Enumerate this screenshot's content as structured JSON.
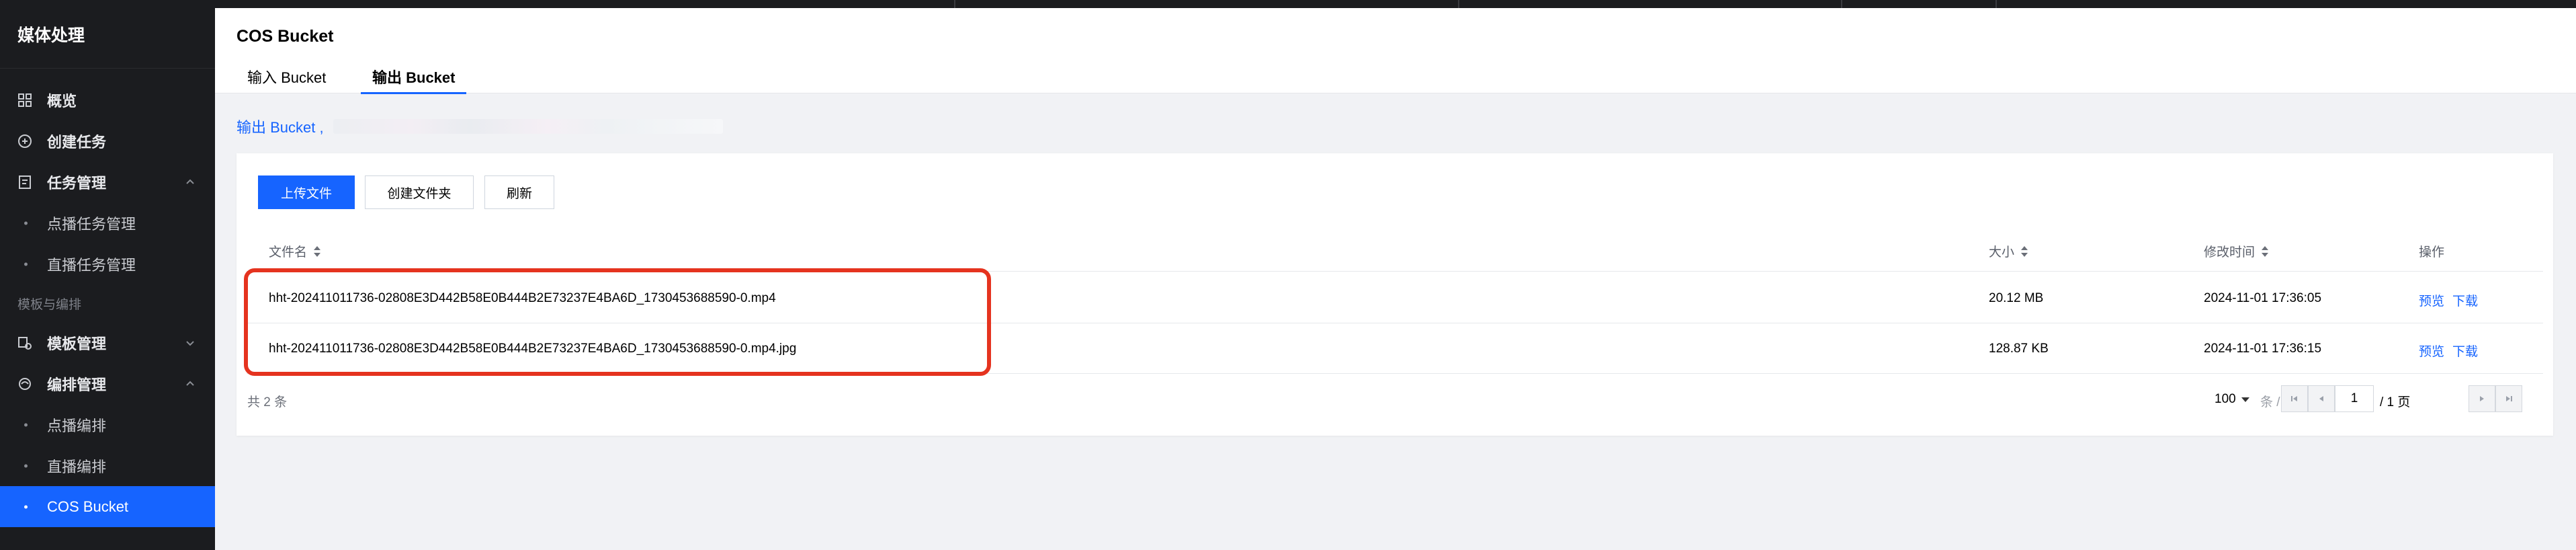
{
  "sidebar": {
    "brand": "媒体处理",
    "items": [
      {
        "label": "概览",
        "icon": "grid-icon"
      },
      {
        "label": "创建任务",
        "icon": "plus-circle-icon"
      },
      {
        "label": "任务管理",
        "icon": "document-icon",
        "expanded": true
      },
      {
        "label": "点播任务管理"
      },
      {
        "label": "直播任务管理"
      },
      {
        "group": "模板与编排"
      },
      {
        "label": "模板管理",
        "icon": "template-icon",
        "expanded": false
      },
      {
        "label": "编排管理",
        "icon": "flow-icon",
        "expanded": true
      },
      {
        "label": "点播编排"
      },
      {
        "label": "直播编排"
      },
      {
        "label": "COS Bucket",
        "active": true
      }
    ]
  },
  "header": {
    "title": "COS Bucket",
    "tabs": [
      {
        "label": "输入 Bucket",
        "active": false
      },
      {
        "label": "输出 Bucket",
        "active": true
      }
    ]
  },
  "bucket": {
    "prefix": "输出 Bucket ,"
  },
  "toolbar": {
    "upload": "上传文件",
    "create_folder": "创建文件夹",
    "refresh": "刷新"
  },
  "table": {
    "columns": [
      "文件名",
      "大小",
      "修改时间",
      "操作"
    ],
    "rows": [
      {
        "name": "hht-202411011736-02808E3D442B58E0B444B2E73237E4BA6D_1730453688590-0.mp4",
        "size": "20.12 MB",
        "modified": "2024-11-01 17:36:05",
        "actions": [
          "预览",
          "下载"
        ]
      },
      {
        "name": "hht-202411011736-02808E3D442B58E0B444B2E73237E4BA6D_1730453688590-0.mp4.jpg",
        "size": "128.87 KB",
        "modified": "2024-11-01 17:36:15",
        "actions": [
          "预览",
          "下载"
        ]
      }
    ]
  },
  "pagination": {
    "total": "共 2 条",
    "page_size": "100",
    "unit": "条 / 页",
    "current_page": "1",
    "total_pages": "/ 1 页"
  },
  "colors": {
    "accent": "#1664ff",
    "sidebar_bg": "#1b1c1f",
    "highlight": "#e5331f"
  }
}
